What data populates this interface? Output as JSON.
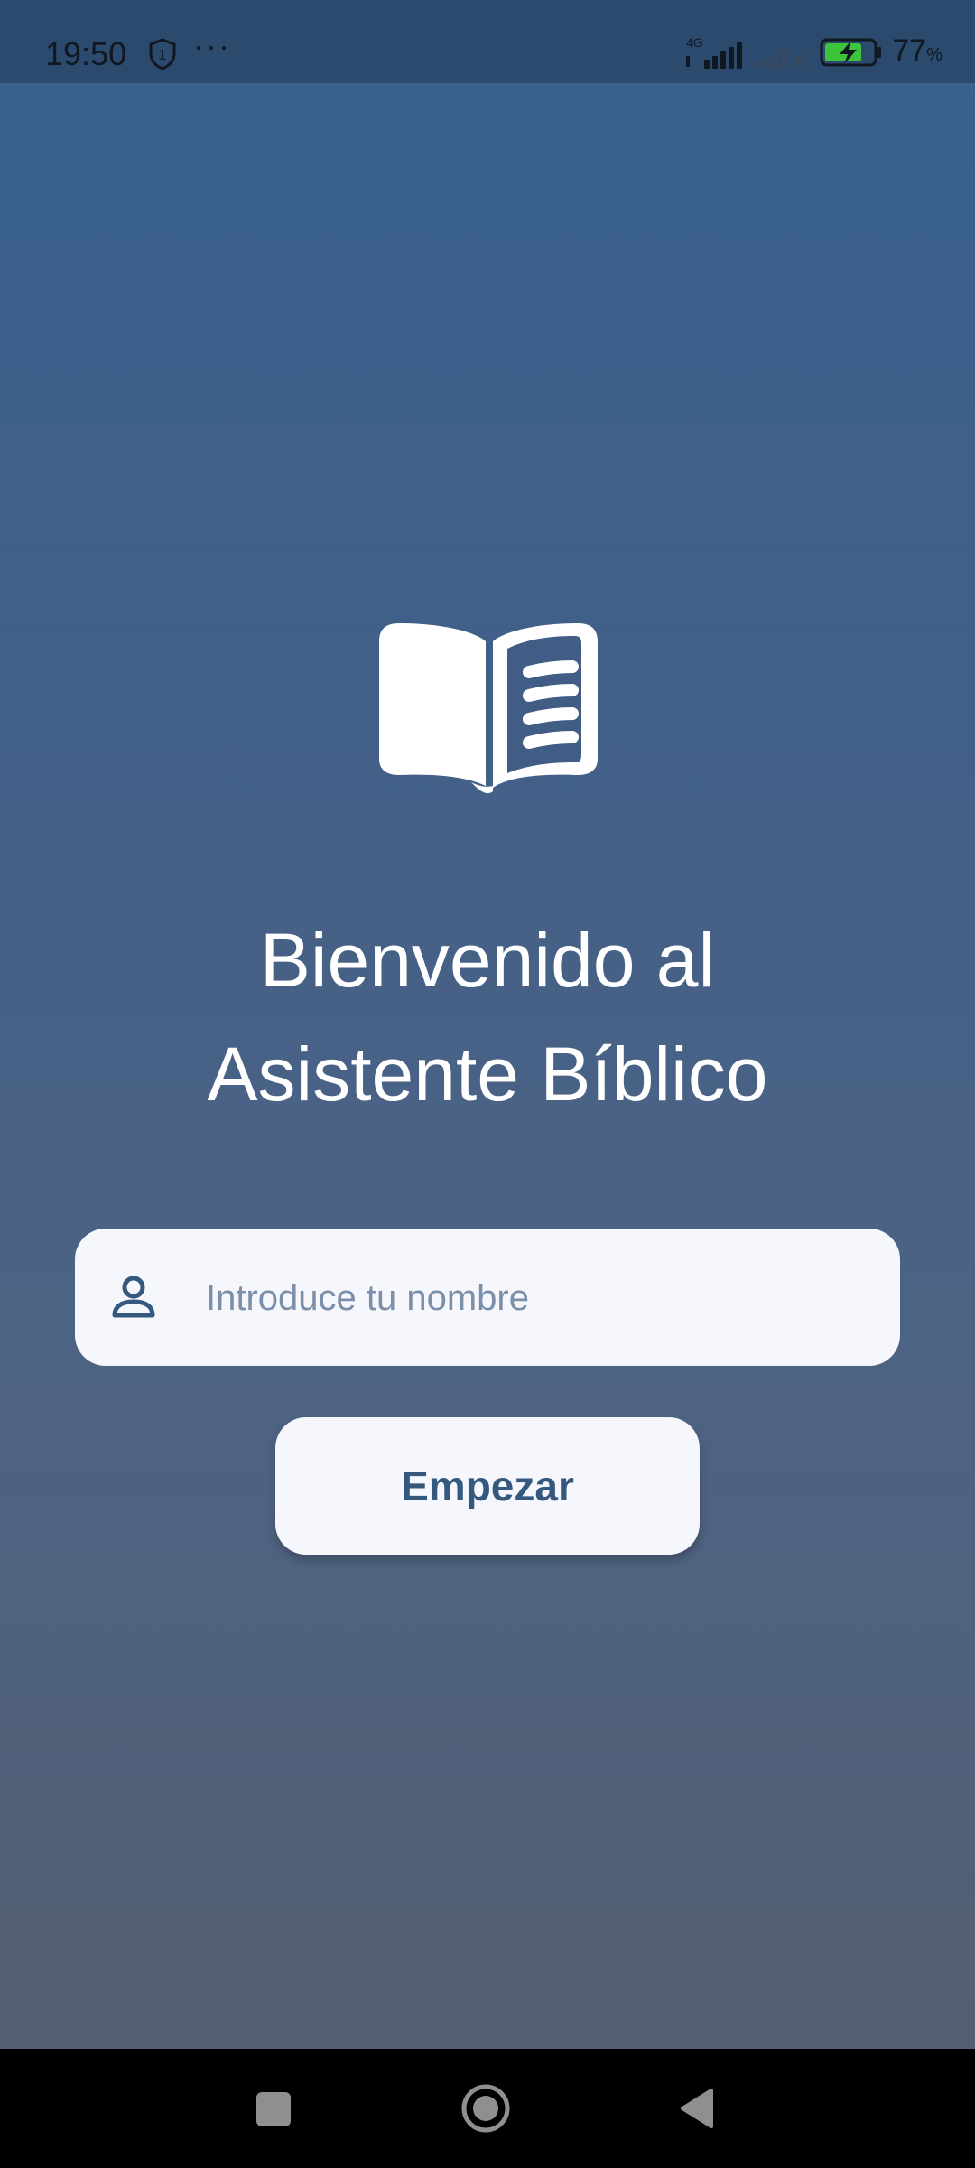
{
  "status_bar": {
    "time": "19:50",
    "notification_badge": "1",
    "overflow": "···",
    "network_type": "4G",
    "battery_percent": "77",
    "battery_unit": "%",
    "battery_level": 0.77,
    "battery_charging": true,
    "icons": [
      "shield-icon",
      "signal-icon",
      "no-signal-icon",
      "battery-charging-icon"
    ]
  },
  "welcome": {
    "line1": "Bienvenido al",
    "line2": "Asistente Bíblico"
  },
  "name_field": {
    "placeholder": "Introduce tu nombre",
    "value": "",
    "icon": "person-icon"
  },
  "start_button": {
    "label": "Empezar"
  },
  "hero_icon": "open-book-icon",
  "nav": {
    "icons": [
      "recents-square-icon",
      "home-circle-icon",
      "back-triangle-icon"
    ]
  },
  "colors": {
    "gradient_top": "#37618e",
    "gradient_bottom": "#545f73",
    "status_bar": "#2c4a6e",
    "field_bg": "#f5f7fc",
    "button_text": "#34587e",
    "placeholder": "#7b8fa8",
    "battery_fill": "#3ec43a"
  }
}
